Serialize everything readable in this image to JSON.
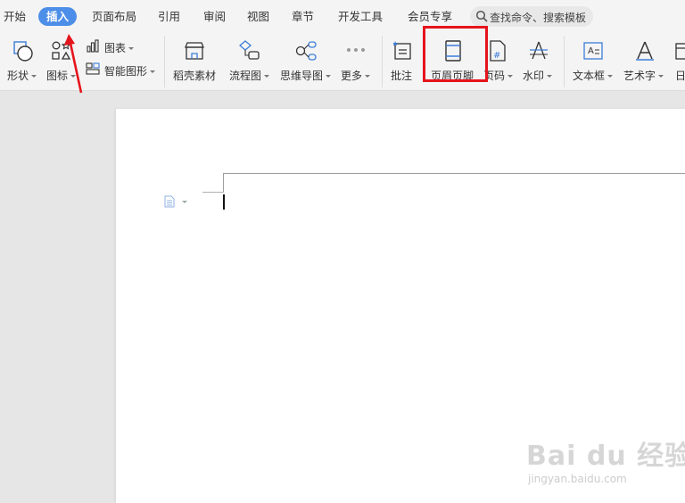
{
  "menu_tabs": [
    "开始",
    "插入",
    "页面布局",
    "引用",
    "审阅",
    "视图",
    "章节",
    "开发工具",
    "会员专享"
  ],
  "active_tab": "插入",
  "search": {
    "placeholder": "查找命令、搜索模板"
  },
  "ribbon": {
    "shapes": "形状",
    "icons": "图标",
    "chart": "图表",
    "smart_art": "智能图形",
    "materials": "稻壳素材",
    "flowchart": "流程图",
    "mindmap": "思维导图",
    "more": "更多",
    "comment": "批注",
    "header_footer": "页眉页脚",
    "page_number": "页码",
    "watermark": "水印",
    "textbox": "文本框",
    "wordart": "艺术字",
    "date": "日"
  },
  "watermark_overlay": {
    "main": "Bai du 经验",
    "sub": "jingyan.baidu.com"
  },
  "colors": {
    "accent": "#4c8ee8",
    "highlight": "#e5141c",
    "icon_blue": "#3c7dd8"
  }
}
